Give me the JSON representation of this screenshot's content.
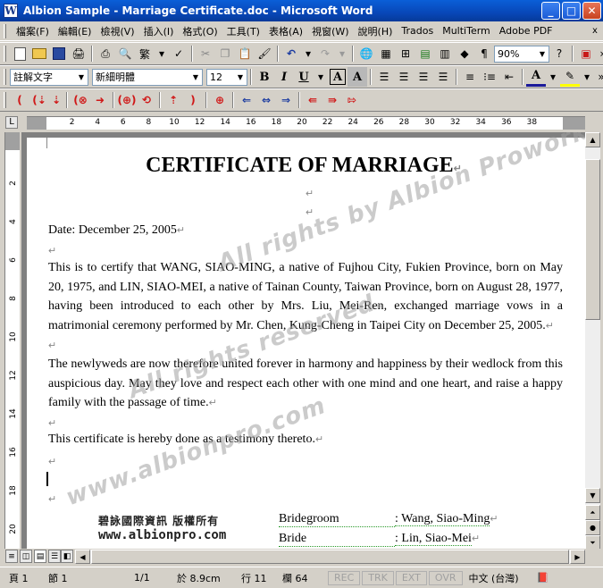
{
  "window": {
    "title": "Albion Sample - Marriage Certificate.doc - Microsoft Word",
    "min": "_",
    "max": "□",
    "close": "✕"
  },
  "menu": {
    "items": [
      "檔案(F)",
      "編輯(E)",
      "檢視(V)",
      "插入(I)",
      "格式(O)",
      "工具(T)",
      "表格(A)",
      "視窗(W)",
      "說明(H)",
      "Trados",
      "MultiTerm",
      "Adobe PDF"
    ],
    "help_box": "x"
  },
  "toolbar": {
    "zoom": "90%",
    "style": "註解文字",
    "font": "新細明體",
    "size": "12",
    "bold": "B",
    "italic": "I",
    "underline": "U",
    "border_a": "A",
    "shade_a": "A",
    "font_color_a": "A"
  },
  "ruler": {
    "h_ticks": [
      "2",
      "4",
      "6",
      "8",
      "10",
      "12",
      "14",
      "16",
      "18",
      "20",
      "22",
      "24",
      "26",
      "28",
      "30",
      "32",
      "34",
      "36",
      "38"
    ],
    "v_ticks": [
      "2",
      "4",
      "6",
      "8",
      "10",
      "12",
      "14",
      "16",
      "18",
      "20"
    ],
    "corner": "L"
  },
  "document": {
    "title": "CERTIFICATE OF MARRIAGE",
    "date": "Date: December 25, 2005",
    "para1": "This is to certify that WANG, SIAO-MING, a native of Fujhou City, Fukien Province, born on May 20, 1975, and LIN, SIAO-MEI, a native of Tainan County, Taiwan Province, born on August 28, 1977, having been introduced to each other by Mrs. Liu, Mei-Ren, exchanged marriage vows in a matrimonial ceremony performed by Mr. Chen, Kung-Cheng in Taipei City on December 25, 2005.",
    "para2": "The newlyweds are now therefore united forever in harmony and happiness by their wedlock from this auspicious day. May they love and respect each other with one mind and one heart, and raise a happy family with the passage of time.",
    "para3": "This certificate is hereby done as a testimony thereto.",
    "para_mark": "↵",
    "sig_cn": "碧詠國際資訊 版權所有",
    "sig_url": "www.albionpro.com",
    "bridegroom_label": "Bridegroom",
    "bridegroom_value": ": Wang, Siao-Ming",
    "bride_label": "Bride",
    "bride_value": ": Lin, Siao-Mei"
  },
  "watermarks": [
    "All rights by Albion Proworks",
    "All rights reserved.",
    "www.albionpro.com"
  ],
  "status": {
    "page": "頁 1",
    "section": "節 1",
    "pages": "1/1",
    "at": "於 8.9cm",
    "line": "行 11",
    "col": "欄 64",
    "rec": "REC",
    "trk": "TRK",
    "ext": "EXT",
    "ovr": "OVR",
    "lang": "中文 (台灣)"
  }
}
